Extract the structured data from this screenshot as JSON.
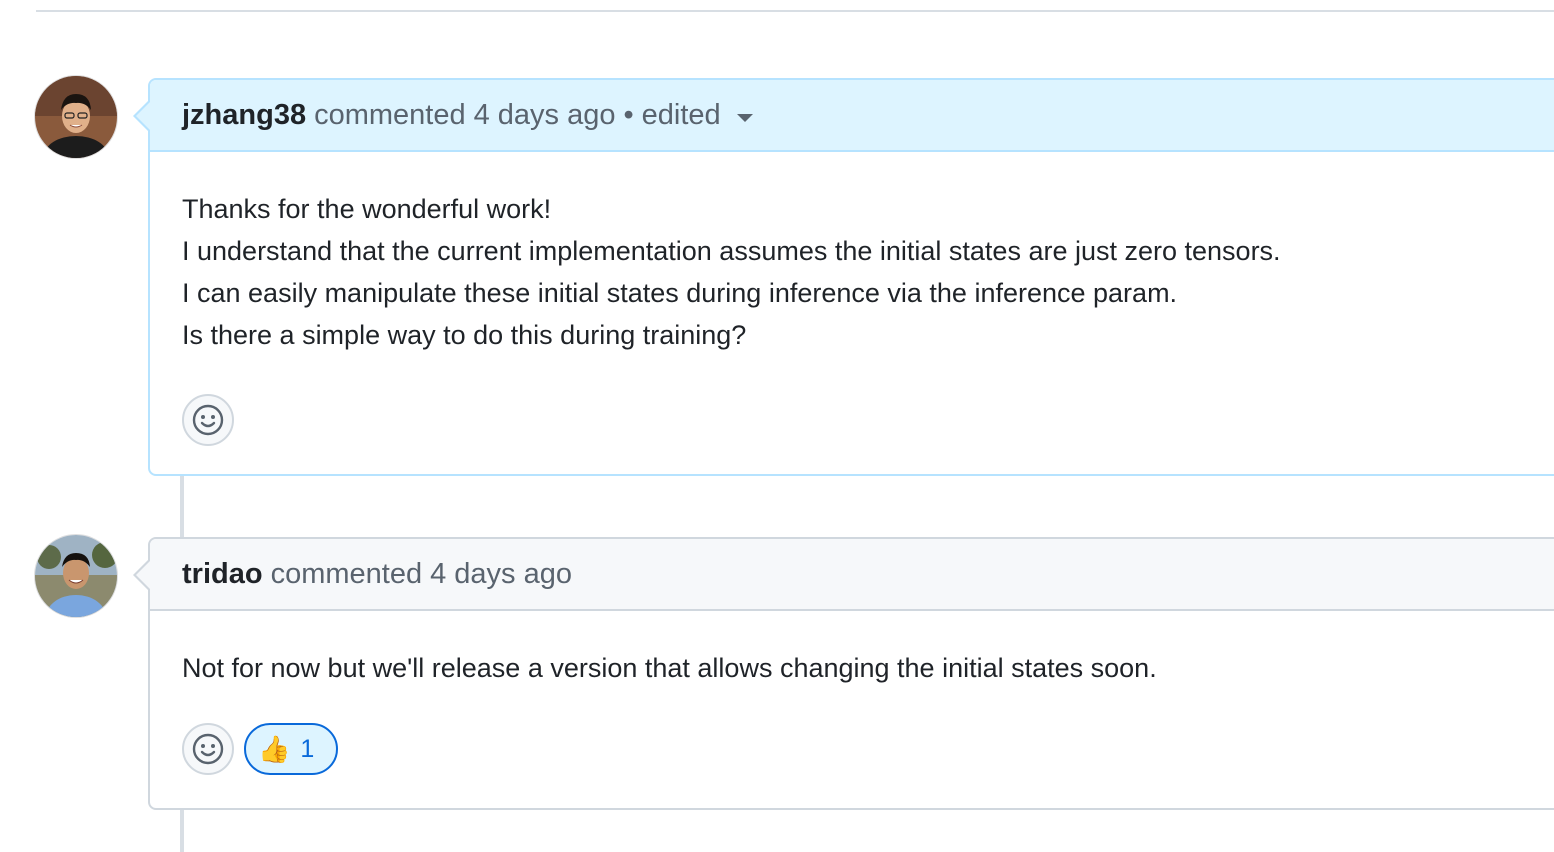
{
  "comments": [
    {
      "author": "jzhang38",
      "action": "commented",
      "timestamp": "4 days ago",
      "separator": "•",
      "edited_label": "edited",
      "highlighted": true,
      "avatar_icon": "user-avatar",
      "body": [
        "Thanks for the wonderful work!",
        "I understand that the current implementation assumes the initial states are just zero tensors.",
        "I can easily manipulate these initial states during inference via the inference param.",
        "Is there a simple way to do this during training?"
      ],
      "reactions": []
    },
    {
      "author": "tridao",
      "action": "commented",
      "timestamp": "4 days ago",
      "highlighted": false,
      "avatar_icon": "user-avatar",
      "body": [
        "Not for now but we'll release a version that allows changing the initial states soon."
      ],
      "reactions": [
        {
          "emoji": "👍",
          "icon": "thumbs-up-icon",
          "count": "1"
        }
      ]
    }
  ],
  "add_reaction_icon": "smiley-icon",
  "colors": {
    "highlight_header": "#ddf4ff",
    "highlight_border": "#b6e3ff",
    "default_header": "#f6f8fa",
    "border": "#d0d7de",
    "link": "#0969da",
    "muted_text": "#59636e"
  }
}
